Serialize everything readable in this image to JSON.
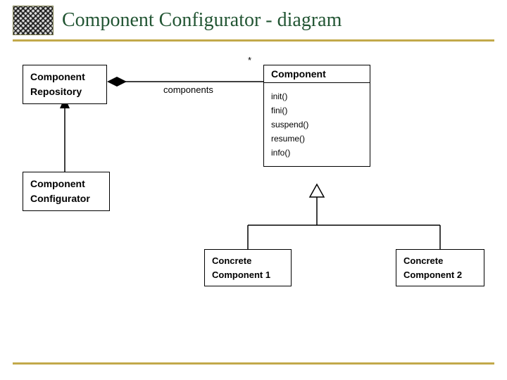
{
  "header": {
    "title": "Component Configurator - diagram"
  },
  "diagram": {
    "repository": {
      "line1": "Component",
      "line2": "Repository"
    },
    "configurator": {
      "line1": "Component",
      "line2": "Configurator"
    },
    "component": {
      "name": "Component",
      "ops": [
        "init()",
        "fini()",
        "suspend()",
        "resume()",
        "info()"
      ]
    },
    "concrete1": {
      "line1": "Concrete",
      "line2": "Component 1"
    },
    "concrete2": {
      "line1": "Concrete",
      "line2": "Component 2"
    },
    "assoc": {
      "role": "components",
      "mult": "*"
    }
  }
}
